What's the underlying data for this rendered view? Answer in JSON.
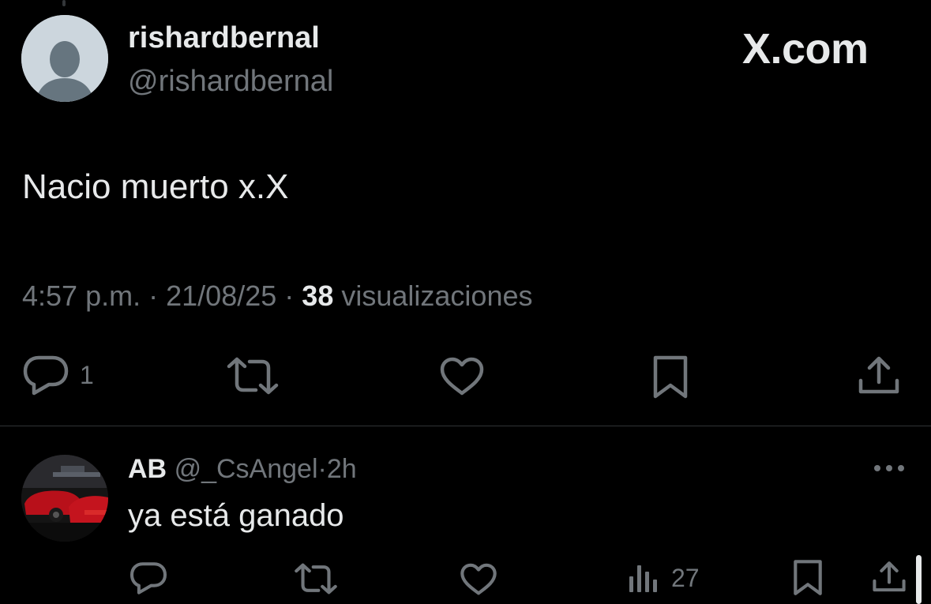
{
  "tweet": {
    "author_name": "rishardbernal",
    "author_handle": "@rishardbernal",
    "brand": "X.com",
    "text": "Nacio muerto x.X",
    "time": "4:57 p.m.",
    "separator": "·",
    "date": "21/08/25",
    "views_count": "38",
    "views_label": "visualizaciones",
    "actions": {
      "reply_icon": "reply-icon",
      "reply_count": "1",
      "retweet_icon": "retweet-icon",
      "like_icon": "heart-icon",
      "bookmark_icon": "bookmark-icon",
      "share_icon": "share-icon"
    }
  },
  "reply": {
    "author_name": "AB",
    "author_handle": "@_CsAngel",
    "separator": "·",
    "time": "2h",
    "text": "ya está ganado",
    "actions": {
      "views_count": "27"
    }
  },
  "colors": {
    "background": "#000000",
    "text_primary": "#e7e9ea",
    "text_secondary": "#71767b",
    "divider": "#2f3336"
  }
}
